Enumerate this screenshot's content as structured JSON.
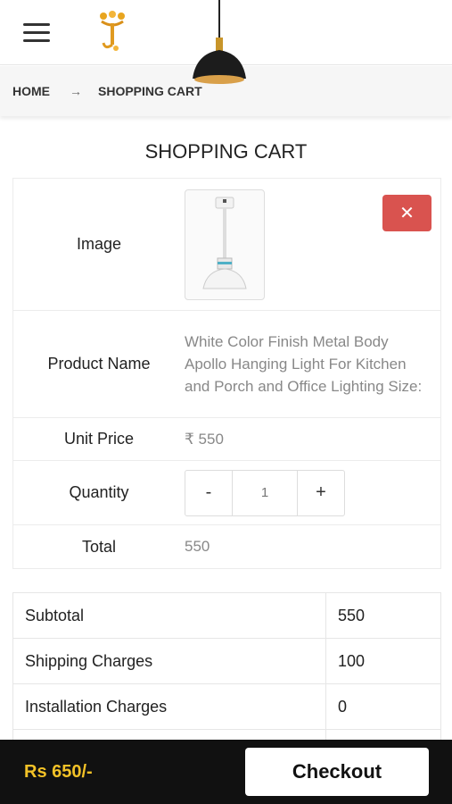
{
  "header": {
    "menu_icon": "hamburger-menu-icon",
    "logo_icon": "brand-logo-icon"
  },
  "breadcrumb": {
    "home": "HOME",
    "separator": "→",
    "current": "SHOPPING CART"
  },
  "page": {
    "title": "SHOPPING CART"
  },
  "cart": {
    "labels": {
      "image": "Image",
      "product_name": "Product Name",
      "unit_price": "Unit Price",
      "quantity": "Quantity",
      "total": "Total"
    },
    "item": {
      "name": "White Color Finish Metal Body Apollo Hanging Light For Kitchen and Porch and Office Lighting Size:",
      "unit_price": "₹ 550",
      "quantity": "1",
      "total": "550",
      "remove_icon": "close-x-icon",
      "remove_symbol": "✕"
    },
    "qty_controls": {
      "decrement": "-",
      "increment": "+"
    }
  },
  "summary": {
    "rows": [
      {
        "label": "Subtotal",
        "value": "550"
      },
      {
        "label": "Shipping Charges",
        "value": "100"
      },
      {
        "label": "Installation Charges",
        "value": "0"
      }
    ]
  },
  "footer": {
    "total": "Rs 650/-",
    "checkout": "Checkout"
  },
  "colors": {
    "accent_yellow": "#f3c227",
    "remove_red": "#d9534f",
    "footer_bg": "#111111"
  }
}
